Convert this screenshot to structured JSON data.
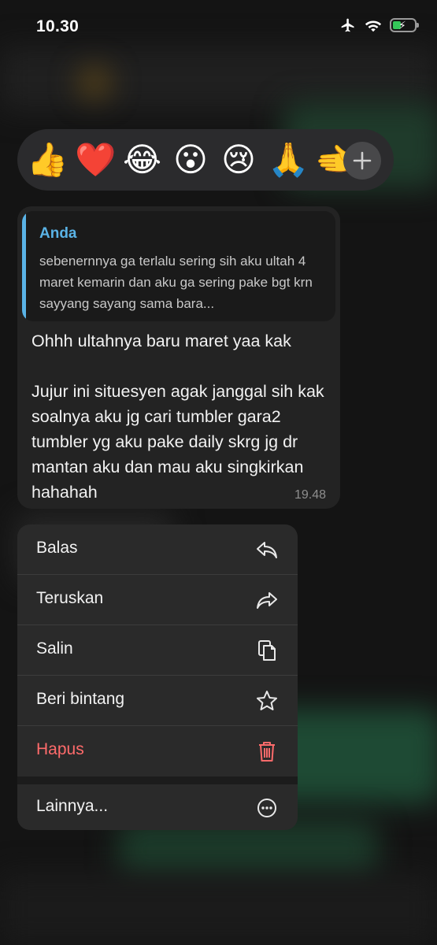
{
  "status_bar": {
    "time": "10.30",
    "icons": [
      "airplane-mode-icon",
      "wifi-icon",
      "battery-charging-icon"
    ],
    "battery_level": 0.4
  },
  "reactions": {
    "emojis": [
      {
        "name": "thumbs-up",
        "char": "👍"
      },
      {
        "name": "red-heart",
        "char": "❤️"
      },
      {
        "name": "tears-of-joy",
        "char": "😂"
      },
      {
        "name": "surprised",
        "char": "😮"
      },
      {
        "name": "crying",
        "char": "😢"
      },
      {
        "name": "folded-hands",
        "char": "🙏"
      },
      {
        "name": "pointing-hand",
        "char": "🫲"
      }
    ],
    "more_icon": "plus-icon"
  },
  "message": {
    "quote": {
      "author": "Anda",
      "text": "sebenernnya ga terlalu sering sih aku ultah 4 maret kemarin dan aku ga sering pake bgt krn sayyang sayang sama bara..."
    },
    "text": "Ohhh ultahnya baru maret yaa kak\n\nJujur ini situesyen agak janggal sih kak soalnya aku jg cari tumbler gara2 tumbler yg aku pake daily skrg jg dr mantan aku dan mau aku singkirkan hahahah",
    "time": "19.48"
  },
  "menu": {
    "items": [
      {
        "label": "Balas",
        "icon": "reply-icon"
      },
      {
        "label": "Teruskan",
        "icon": "forward-icon"
      },
      {
        "label": "Salin",
        "icon": "copy-icon"
      },
      {
        "label": "Beri bintang",
        "icon": "star-icon"
      },
      {
        "label": "Hapus",
        "icon": "trash-icon"
      },
      {
        "label": "Lainnya...",
        "icon": "more-icon"
      }
    ],
    "danger_color": "#ff6b6b"
  },
  "colors": {
    "accent_blue": "#5ab3e6",
    "battery_green": "#34c759"
  }
}
